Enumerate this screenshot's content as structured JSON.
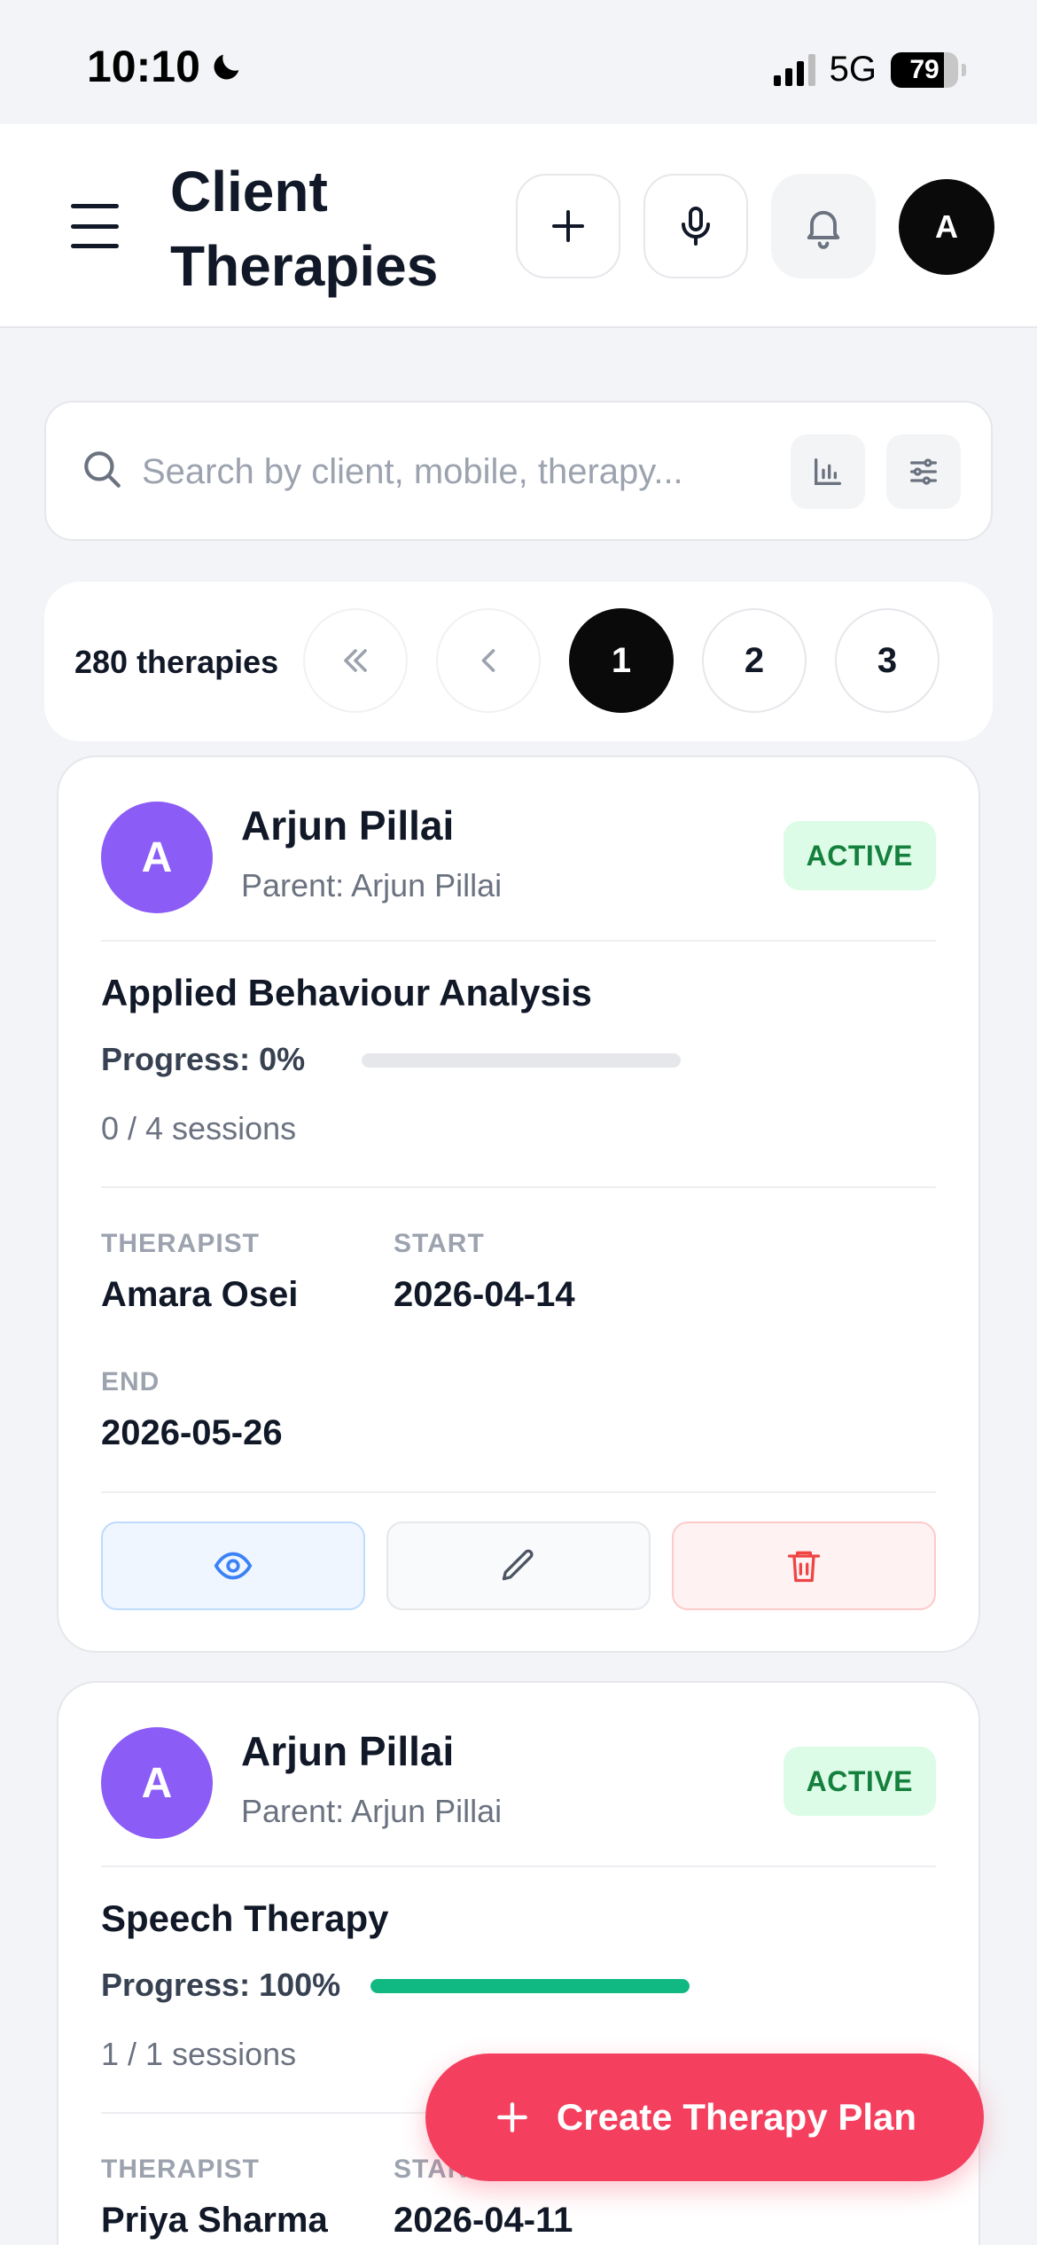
{
  "status_bar": {
    "time": "10:10",
    "network": "5G",
    "battery": "79",
    "battery_level": 0.79
  },
  "header": {
    "title": "Client Therapies",
    "avatar_initial": "A"
  },
  "search": {
    "placeholder": "Search by client, mobile, therapy..."
  },
  "pagination": {
    "count_label": "280 therapies",
    "pages": [
      "1",
      "2",
      "3"
    ],
    "active_page": "1"
  },
  "therapies": [
    {
      "avatar_initial": "A",
      "client_name": "Arjun Pillai",
      "parent": "Parent: Arjun Pillai",
      "status": "ACTIVE",
      "therapy_name": "Applied Behaviour Analysis",
      "progress_label": "Progress: 0%",
      "progress": 0,
      "sessions": "0 / 4 sessions",
      "therapist_label": "THERAPIST",
      "therapist": "Amara Osei",
      "start_label": "START",
      "start": "2026-04-14",
      "end_label": "END",
      "end": "2026-05-26"
    },
    {
      "avatar_initial": "A",
      "client_name": "Arjun Pillai",
      "parent": "Parent: Arjun Pillai",
      "status": "ACTIVE",
      "therapy_name": "Speech Therapy",
      "progress_label": "Progress: 100%",
      "progress": 1,
      "sessions": "1 / 1 sessions",
      "therapist_label": "THERAPIST",
      "therapist": "Priya Sharma",
      "start_label": "START",
      "start": "2026-04-11"
    }
  ],
  "fab": {
    "label": "Create Therapy Plan"
  },
  "icons": [
    "menu-icon",
    "plus-icon",
    "microphone-icon",
    "bell-icon",
    "search-icon",
    "chart-icon",
    "sliders-icon",
    "double-chevron-left-icon",
    "chevron-left-icon",
    "eye-icon",
    "pencil-icon",
    "trash-icon"
  ],
  "colors": {
    "accent": "#f43f5e",
    "avatar": "#8b5cf6",
    "active_badge_bg": "#dcfce7",
    "active_badge_text": "#15803d",
    "progress_fill": "#10b981"
  }
}
